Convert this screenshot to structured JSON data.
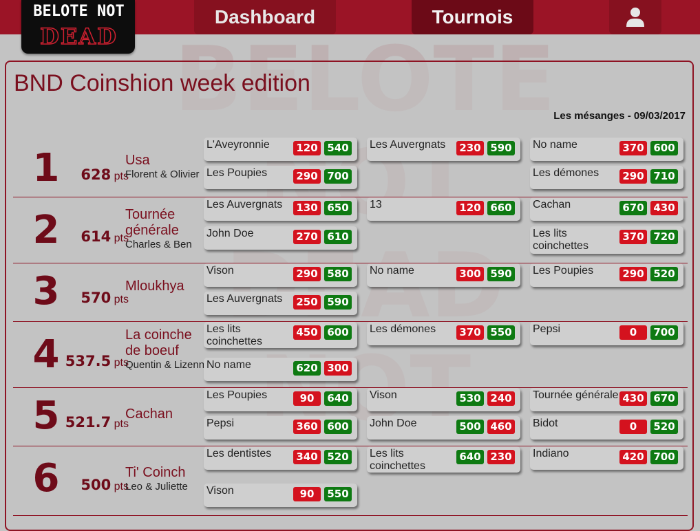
{
  "logo": {
    "line1": "BELOTE NOT",
    "line2": "DEAD"
  },
  "nav": {
    "dashboard": "Dashboard",
    "tournois": "Tournois",
    "user_icon": "user-icon"
  },
  "watermark_icon": "belote-not-dead-logo",
  "tournament": {
    "title": "BND Coinshion week edition",
    "subtitle": "Les mésanges - 09/03/2017",
    "pts_unit": "pts"
  },
  "colors": {
    "accent": "#9b1426",
    "win": "#0e7a12",
    "loss": "#d4121e"
  },
  "rankings": [
    {
      "rank": "1",
      "points": "628",
      "team": "Usa",
      "players": "Florent & Olivier",
      "matches": [
        {
          "opponent": "L'Aveyronnie",
          "score": "120",
          "opp_score": "540"
        },
        {
          "opponent": "Les Auvergnats",
          "score": "230",
          "opp_score": "590"
        },
        {
          "opponent": "No name",
          "score": "370",
          "opp_score": "600"
        },
        {
          "opponent": "Les Poupies",
          "score": "290",
          "opp_score": "700"
        },
        {
          "opponent": "Les démones",
          "score": "290",
          "opp_score": "710"
        }
      ]
    },
    {
      "rank": "2",
      "points": "614",
      "team": "Tournée générale",
      "players": "Charles & Ben",
      "matches": [
        {
          "opponent": "Les Auvergnats",
          "score": "130",
          "opp_score": "650"
        },
        {
          "opponent": "13",
          "score": "120",
          "opp_score": "660"
        },
        {
          "opponent": "Cachan",
          "score": "670",
          "opp_score": "430"
        },
        {
          "opponent": "John Doe",
          "score": "270",
          "opp_score": "610"
        },
        {
          "opponent": "Les lits coinchettes",
          "score": "370",
          "opp_score": "720"
        }
      ]
    },
    {
      "rank": "3",
      "points": "570",
      "team": "Mloukhya",
      "players": "",
      "matches": [
        {
          "opponent": "Vison",
          "score": "290",
          "opp_score": "580"
        },
        {
          "opponent": "No name",
          "score": "300",
          "opp_score": "590"
        },
        {
          "opponent": "Les Poupies",
          "score": "290",
          "opp_score": "520"
        },
        {
          "opponent": "Les Auvergnats",
          "score": "250",
          "opp_score": "590"
        }
      ]
    },
    {
      "rank": "4",
      "points": "537.5",
      "team": "La coinche de boeuf",
      "players": "Quentin & Lizenn",
      "matches": [
        {
          "opponent": "Les lits coinchettes",
          "score": "450",
          "opp_score": "600"
        },
        {
          "opponent": "Les démones",
          "score": "370",
          "opp_score": "550"
        },
        {
          "opponent": "Pepsi",
          "score": "0",
          "opp_score": "700"
        },
        {
          "opponent": "No name",
          "score": "620",
          "opp_score": "300"
        }
      ]
    },
    {
      "rank": "5",
      "points": "521.7",
      "team": "Cachan",
      "players": "",
      "matches": [
        {
          "opponent": "Les Poupies",
          "score": "90",
          "opp_score": "640"
        },
        {
          "opponent": "Vison",
          "score": "530",
          "opp_score": "240"
        },
        {
          "opponent": "Tournée générale",
          "score": "430",
          "opp_score": "670"
        },
        {
          "opponent": "Pepsi",
          "score": "360",
          "opp_score": "600"
        },
        {
          "opponent": "John Doe",
          "score": "500",
          "opp_score": "460"
        },
        {
          "opponent": "Bidot",
          "score": "0",
          "opp_score": "520"
        }
      ]
    },
    {
      "rank": "6",
      "points": "500",
      "team": "Ti' Coinch",
      "players": "Leo & Juliette",
      "matches": [
        {
          "opponent": "Les dentistes",
          "score": "340",
          "opp_score": "520"
        },
        {
          "opponent": "Les lits coinchettes",
          "score": "640",
          "opp_score": "230"
        },
        {
          "opponent": "Indiano",
          "score": "420",
          "opp_score": "700"
        },
        {
          "opponent": "Vison",
          "score": "90",
          "opp_score": "550"
        }
      ]
    }
  ]
}
